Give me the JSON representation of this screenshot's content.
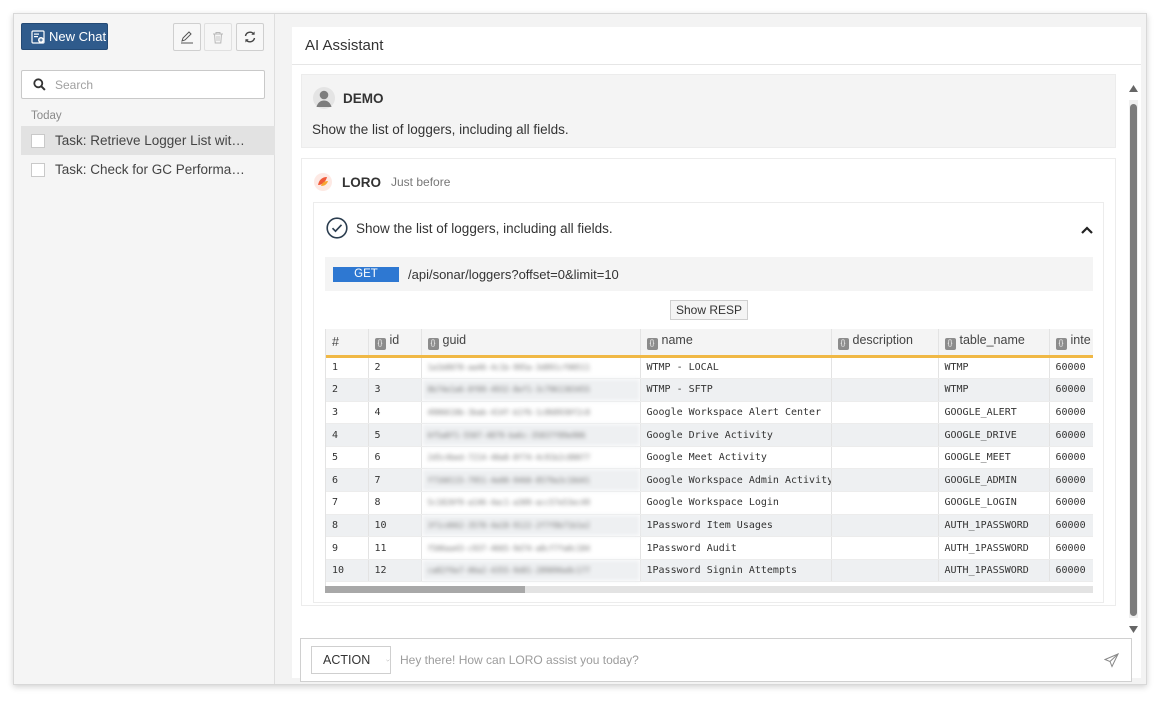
{
  "sidebar": {
    "new_chat_label": "New Chat",
    "search_placeholder": "Search",
    "group_label": "Today",
    "tasks": [
      {
        "label": "Task: Retrieve Logger List with ..."
      },
      {
        "label": "Task: Check for GC Performan..."
      }
    ]
  },
  "main": {
    "title": "AI Assistant",
    "user_message": {
      "sender": "DEMO",
      "text": "Show the list of loggers, including all fields."
    },
    "bot_message": {
      "sender": "LORO",
      "time": "Just before",
      "task_title": "Show the list of loggers, including all fields.",
      "request": {
        "method": "GET",
        "url": "/api/sonar/loggers?offset=0&limit=10"
      },
      "show_resp_label": "Show RESP",
      "table": {
        "columns": [
          "#",
          "id",
          "guid",
          "name",
          "description",
          "table_name",
          "inte"
        ],
        "rows": [
          {
            "n": "1",
            "id": "2",
            "guid": "1a1b8070-aa46-4c1b-995a-3d891cf00511",
            "name": "WTMP - LOCAL",
            "description": "",
            "table_name": "WTMP",
            "inte": "60000"
          },
          {
            "n": "2",
            "id": "3",
            "guid": "8b74e1a6-8f09-4932-8ef1-3c7961303455",
            "name": "WTMP - SFTP",
            "description": "",
            "table_name": "WTMP",
            "inte": "60000"
          },
          {
            "n": "3",
            "id": "4",
            "guid": "4906610b-3bab-414f-b1f6-1c868930f2c0",
            "name": "Google Workspace Alert Center",
            "description": "",
            "table_name": "GOOGLE_ALERT",
            "inte": "60000"
          },
          {
            "n": "4",
            "id": "5",
            "guid": "6f5a8f1-5507-4879-ba6c-35837f89e906",
            "name": "Google Drive Activity",
            "description": "",
            "table_name": "GOOGLE_DRIVE",
            "inte": "60000"
          },
          {
            "n": "5",
            "id": "6",
            "guid": "2d5c4bed-7214-40a8-8f74-4c91b2c88077",
            "name": "Google Meet Activity",
            "description": "",
            "table_name": "GOOGLE_MEET",
            "inte": "60000"
          },
          {
            "n": "6",
            "id": "7",
            "guid": "f7160115-7951-4e00-9460-8579a3c10d41",
            "name": "Google Workspace Admin Activity",
            "description": "",
            "table_name": "GOOGLE_ADMIN",
            "inte": "60000"
          },
          {
            "n": "7",
            "id": "8",
            "guid": "5c1820f9-a146-4ac1-a309-acc57e53ec49",
            "name": "Google Workspace Login",
            "description": "",
            "table_name": "GOOGLE_LOGIN",
            "inte": "60000"
          },
          {
            "n": "8",
            "id": "10",
            "guid": "3f1cd662-3570-4a18-9122-2f7f8b71b1e2",
            "name": "1Password Item Usages",
            "description": "",
            "table_name": "AUTH_1PASSWORD",
            "inte": "60000"
          },
          {
            "n": "9",
            "id": "11",
            "guid": "f506aa43-c937-4665-9d74-a8cf7fa0c184",
            "name": "1Password Audit",
            "description": "",
            "table_name": "AUTH_1PASSWORD",
            "inte": "60000"
          },
          {
            "n": "10",
            "id": "12",
            "guid": "ca82f6e7-06a2-4355-9d81-289096e8c177",
            "name": "1Password Signin Attempts",
            "description": "",
            "table_name": "AUTH_1PASSWORD",
            "inte": "60000"
          }
        ]
      }
    }
  },
  "input": {
    "action_label": "ACTION",
    "placeholder": "Hey there! How can LORO assist you today?"
  }
}
